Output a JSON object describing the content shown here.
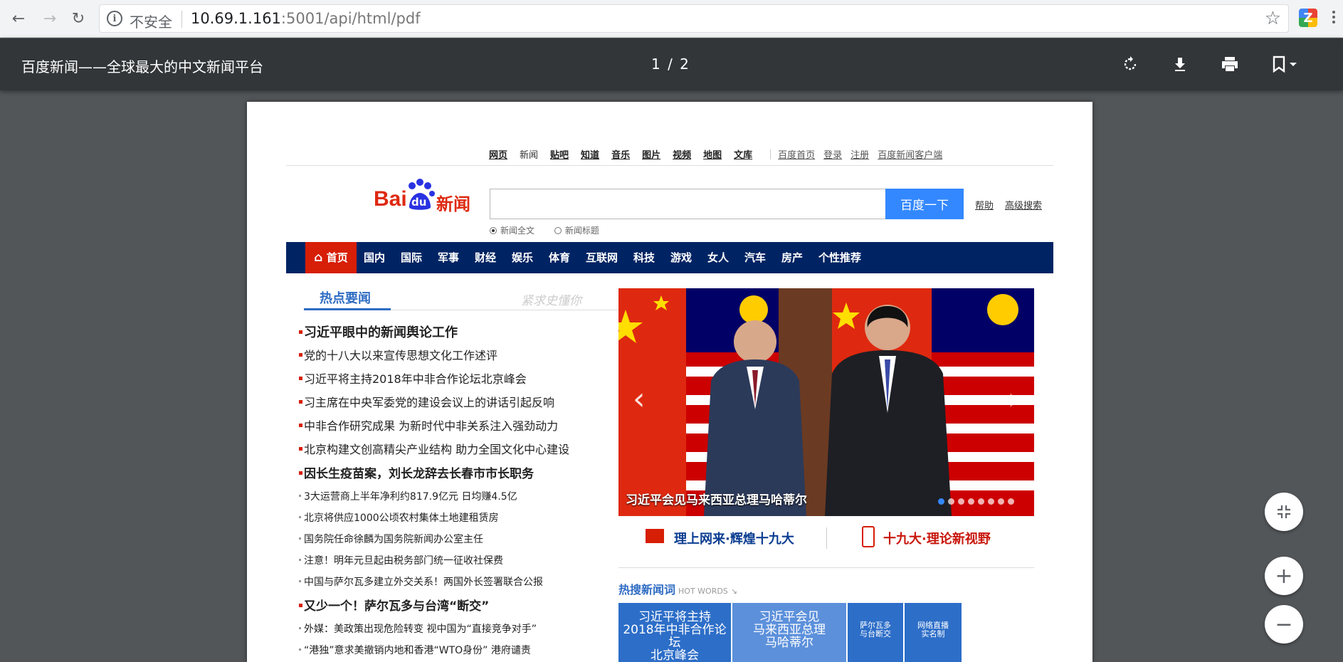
{
  "browser": {
    "security_label": "不安全",
    "url_host": "10.69.1.161",
    "url_path": ":5001/api/html/pdf",
    "ext_letter": "Z"
  },
  "pdf_toolbar": {
    "title": "百度新闻——全球最大的中文新闻平台",
    "page_indicator": "1 / 2"
  },
  "page": {
    "top_nav": [
      "网页",
      "新闻",
      "贴吧",
      "知道",
      "音乐",
      "图片",
      "视频",
      "地图",
      "文库"
    ],
    "top_links": [
      "百度首页",
      "登录",
      "注册",
      "百度新闻客户端"
    ],
    "logo_text": "Bai",
    "logo_du": "du",
    "logo_news": "新闻",
    "search": {
      "button": "百度一下",
      "help": "帮助",
      "advanced": "高级搜索",
      "opt_full": "新闻全文",
      "opt_title": "新闻标题"
    },
    "categories": [
      "首页",
      "国内",
      "国际",
      "军事",
      "财经",
      "娱乐",
      "体育",
      "互联网",
      "科技",
      "游戏",
      "女人",
      "汽车",
      "房产",
      "个性推荐"
    ],
    "hot_title": "热点要闻",
    "motto": "紧求史懂你",
    "headlines": [
      "习近平眼中的新闻舆论工作",
      "党的十八大以来宣传思想文化工作述评",
      "习近平将主持2018年中非合作论坛北京峰会",
      "习主席在中央军委党的建设会议上的讲话引起反响",
      "中非合作研究成果 为新时代中非关系注入强劲动力",
      "北京构建文创高精尖产业结构 助力全国文化中心建设",
      "因长生疫苗案，刘长龙辞去长春市市长职务",
      "3大运营商上半年净利约817.9亿元 日均赚4.5亿",
      "北京将供应1000公顷农村集体土地建租赁房",
      "国务院任命徐麟为国务院新闻办公室主任",
      "注意！明年元旦起由税务部门统一征收社保费",
      "中国与萨尔瓦多建立外交关系！两国外长签署联合公报",
      "又少一个！萨尔瓦多与台湾“断交”",
      "外媒：美政策出现危险转变 视中国为“直接竞争对手”",
      "“港独”意求美撤销内地和香港“WTO身份” 港府谴责"
    ],
    "photo_caption": "习近平会见马来西亚总理马哈蒂尔",
    "banner_left": "理上网来·辉煌十九大",
    "banner_right": "十九大·理论新视野",
    "hotwords": "热搜新闻词",
    "hotwords_en": "HOT WORDS",
    "tiles": [
      {
        "l1": "习近平将主持",
        "l2": "2018年中非合作论坛",
        "l3": "北京峰会"
      },
      {
        "l1": "习近平会见",
        "l2": "马来西亚总理",
        "l3": "马哈蒂尔"
      },
      {
        "l1": "萨尔瓦多",
        "l2": "与台断交"
      },
      {
        "l1": "网络直播",
        "l2": "实名制"
      }
    ]
  }
}
